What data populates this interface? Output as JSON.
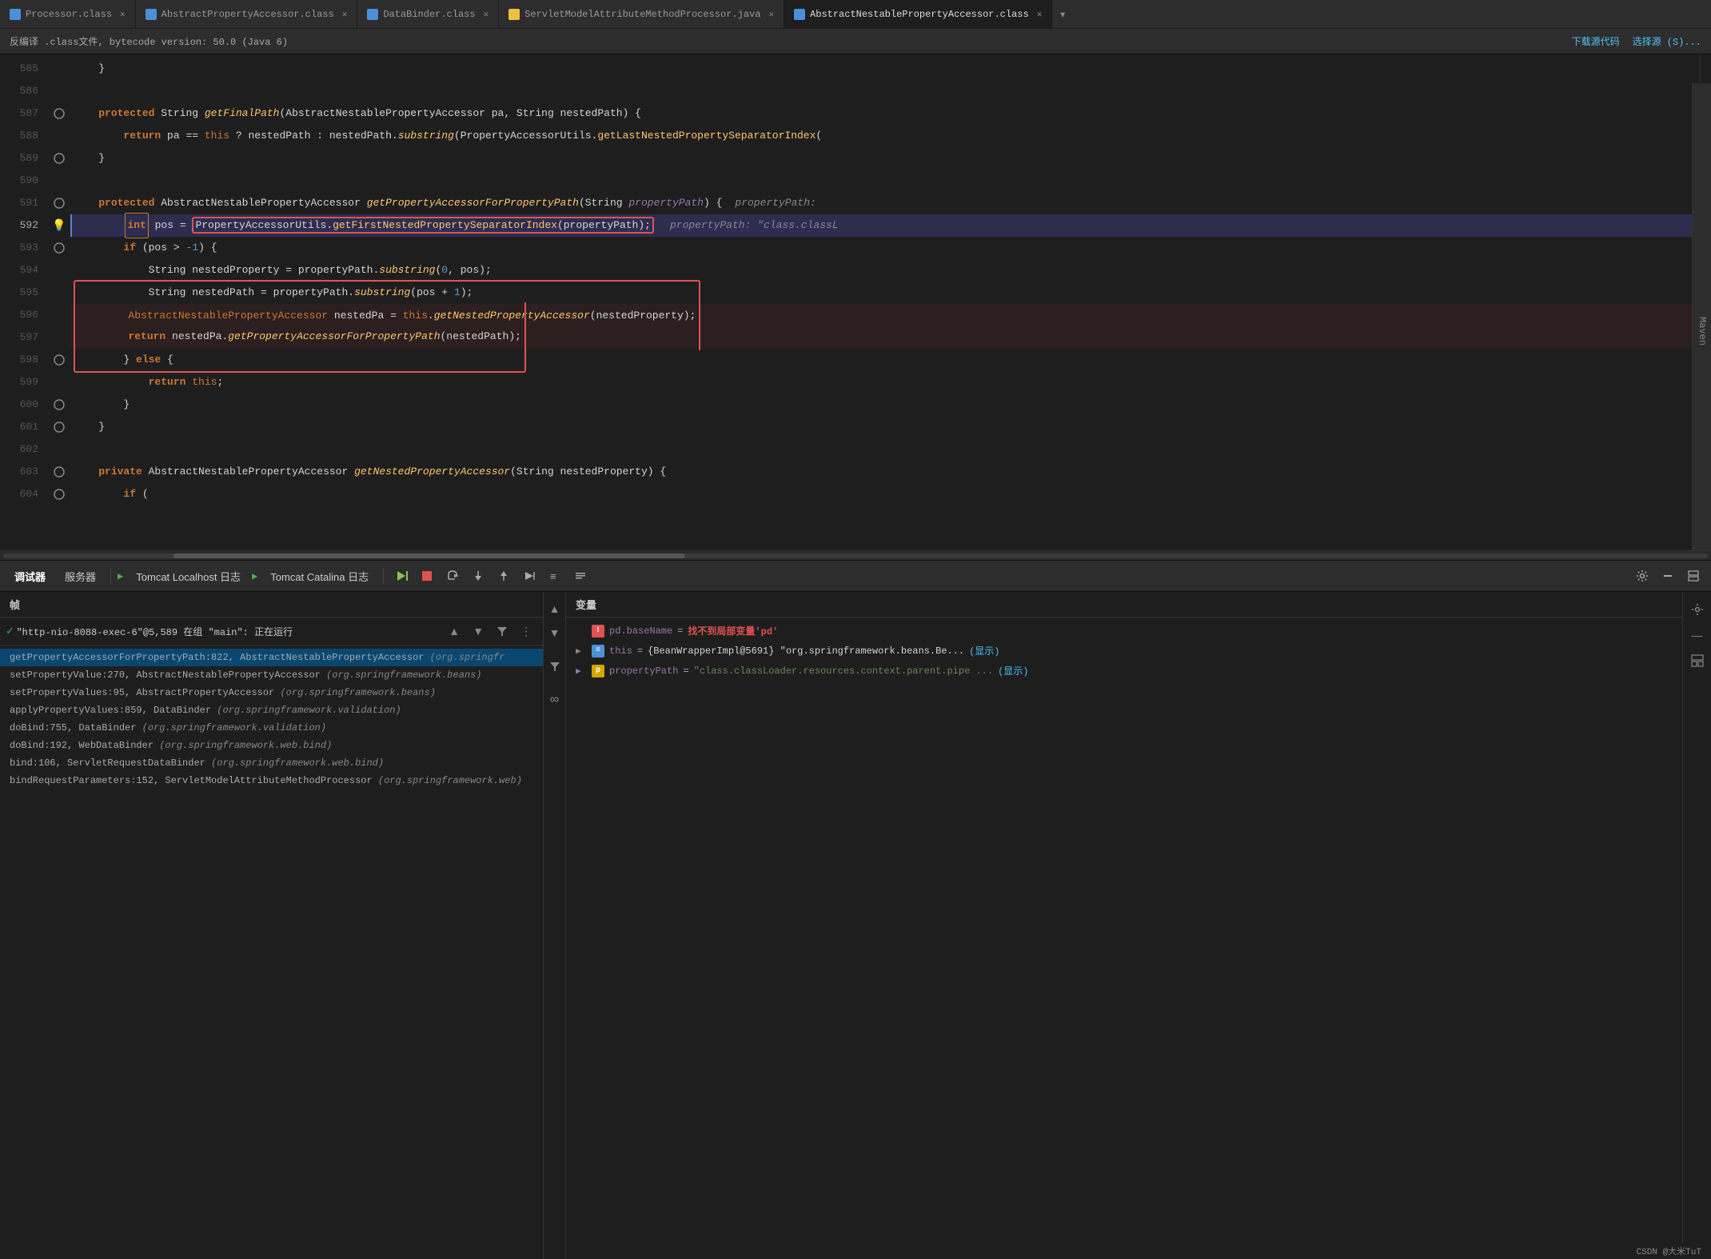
{
  "tabs": [
    {
      "id": "tab1",
      "label": "Processor.class",
      "icon_color": "#4a90d9",
      "active": false
    },
    {
      "id": "tab2",
      "label": "AbstractPropertyAccessor.class",
      "icon_color": "#4a90d9",
      "active": false
    },
    {
      "id": "tab3",
      "label": "DataBinder.class",
      "icon_color": "#4a90d9",
      "active": false
    },
    {
      "id": "tab4",
      "label": "ServletModelAttributeMethodProcessor.java",
      "icon_color": "#f0c040",
      "active": false
    },
    {
      "id": "tab5",
      "label": "AbstractNestablePropertyAccessor.class",
      "icon_color": "#4a90d9",
      "active": true
    }
  ],
  "infobar": {
    "text": "反编译 .class文件, bytecode version: 50.0 (Java 6)",
    "download": "下载源代码",
    "select": "选择源 (S)..."
  },
  "code_lines": [
    {
      "num": 585,
      "content": "    }",
      "indent": 1
    },
    {
      "num": 586,
      "content": ""
    },
    {
      "num": 587,
      "content": "    protected String getFinalPath(AbstractNestablePropertyAccessor pa, String nestedPath) {",
      "has_gutter": "breakpoint_outline"
    },
    {
      "num": 588,
      "content": "        return pa == this ? nestedPath : nestedPath.substring(PropertyAccessorUtils.getLastNestedPropertySeparatorIndex("
    },
    {
      "num": 589,
      "content": "    }",
      "has_gutter": "breakpoint_outline"
    },
    {
      "num": 590,
      "content": ""
    },
    {
      "num": 591,
      "content": "    protected AbstractNestablePropertyAccessor getPropertyAccessorForPropertyPath(String propertyPath) {",
      "has_gutter": "breakpoint_outline"
    },
    {
      "num": 592,
      "content": "        int pos = PropertyAccessorUtils.getFirstNestedPropertySeparatorIndex(propertyPath);",
      "debug": true,
      "bulb": true
    },
    {
      "num": 593,
      "content": "        if (pos > -1) {",
      "has_gutter": "breakpoint_outline"
    },
    {
      "num": 594,
      "content": "            String nestedProperty = propertyPath.substring(0, pos);"
    },
    {
      "num": 595,
      "content": "            String nestedPath = propertyPath.substring(pos + 1);"
    },
    {
      "num": 596,
      "content": "            AbstractNestablePropertyAccessor nestedPa = this.getNestedPropertyAccessor(nestedProperty);",
      "box_start": true
    },
    {
      "num": 597,
      "content": "            return nestedPa.getPropertyAccessorForPropertyPath(nestedPath);",
      "box_end": true
    },
    {
      "num": 598,
      "content": "        } else {",
      "has_gutter": "breakpoint_outline"
    },
    {
      "num": 599,
      "content": "            return this;"
    },
    {
      "num": 600,
      "content": "        }",
      "has_gutter": "breakpoint_outline"
    },
    {
      "num": 601,
      "content": "    }",
      "has_gutter": "breakpoint_outline"
    },
    {
      "num": 602,
      "content": ""
    },
    {
      "num": 603,
      "content": "    private AbstractNestablePropertyAccessor getNestedPropertyAccessor(String nestedProperty) {",
      "has_gutter": "breakpoint_outline"
    },
    {
      "num": 604,
      "content": "        if (",
      "has_gutter": "breakpoint_outline"
    }
  ],
  "toolbar": {
    "debugger_label": "调试器",
    "server_label": "服务器",
    "tomcat_localhost_label": "Tomcat Localhost 日志",
    "tomcat_catalina_label": "Tomcat Catalina 日志"
  },
  "debug_panel": {
    "frames_header": "帧",
    "vars_header": "变量",
    "frames": [
      {
        "selected": true,
        "check": true,
        "method": "getPropertyAccessorForPropertyPath:822",
        "class": "AbstractNestablePropertyAccessor",
        "package": "(org.springfr"
      },
      {
        "method": "setPropertyValue:270",
        "class": "AbstractNestablePropertyAccessor",
        "package": "(org.springframework.beans)"
      },
      {
        "method": "setPropertyValues:95",
        "class": "AbstractPropertyAccessor",
        "package": "(org.springframework.beans)"
      },
      {
        "method": "applyPropertyValues:859",
        "class": "DataBinder",
        "package": "(org.springframework.validation)"
      },
      {
        "method": "doBind:755",
        "class": "DataBinder",
        "package": "(org.springframework.validation)"
      },
      {
        "method": "doBind:192",
        "class": "WebDataBinder",
        "package": "(org.springframework.web.bind)"
      },
      {
        "method": "bind:106",
        "class": "ServletRequestDataBinder",
        "package": "(org.springframework.web.bind)"
      },
      {
        "method": "bindRequestParameters:152",
        "class": "ServletModelAttributeMethodProcessor",
        "package": "(org.springframework.web)"
      }
    ],
    "thread_info": "\"http-nio-8088-exec-6\"@5,589 在组 \"main\": 正在运行",
    "variables": [
      {
        "type": "error",
        "name": "pd.baseName",
        "eq": "=",
        "value": "找不到局部变量'pd'",
        "is_error": true
      },
      {
        "type": "blue",
        "name": "this",
        "eq": "=",
        "value": "{BeanWrapperImpl@5691} \"org.springframework.beans.Be...",
        "link": "显示",
        "expandable": true
      },
      {
        "type": "gold",
        "name": "propertyPath",
        "eq": "=",
        "value": "\"class.classLoader.resources.context.parent.pipe ...",
        "link": "显示",
        "expandable": true
      }
    ]
  },
  "maven_label": "Maven",
  "status": "CSDN @大米TuT"
}
